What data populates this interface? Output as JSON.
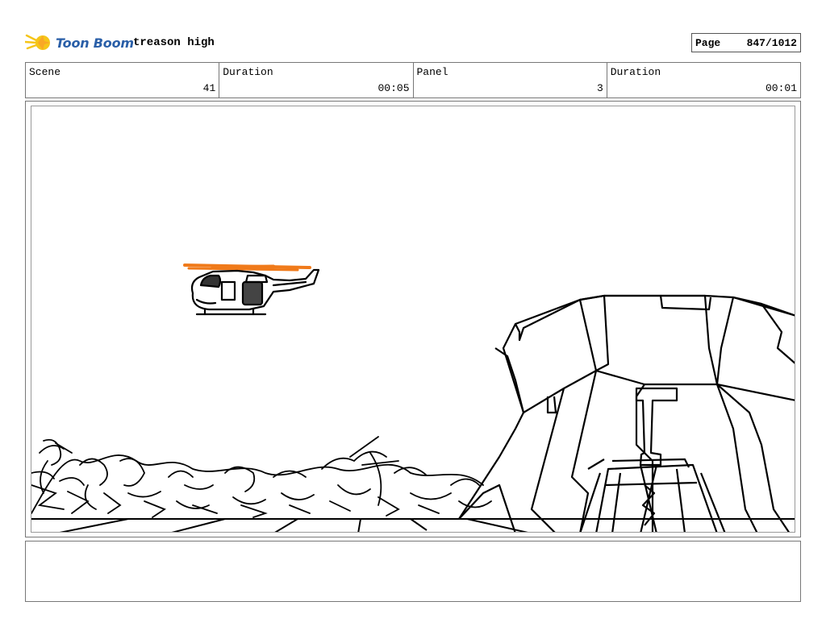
{
  "header": {
    "logo_text": "Toon Boom",
    "project_title": "treason high",
    "page_label": "Page",
    "page_value": "847/1012"
  },
  "info": {
    "scene_label": "Scene",
    "scene_value": "41",
    "scene_duration_label": "Duration",
    "scene_duration_value": "00:05",
    "panel_label": "Panel",
    "panel_value": "3",
    "panel_duration_label": "Duration",
    "panel_duration_value": "00:01"
  },
  "colors": {
    "logo_star": "#f5c518",
    "logo_text": "#2a5fa8",
    "rotor": "#f07a1a",
    "line": "#000000"
  },
  "notes": ""
}
